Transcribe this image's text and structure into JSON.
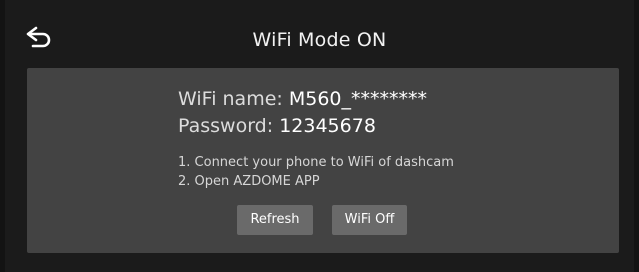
{
  "header": {
    "back_icon": "back-arrow-icon",
    "title": "WiFi Mode ON"
  },
  "wifi_info": {
    "name_label": "WiFi name: ",
    "name_value": "M560_********",
    "password_label": "Password: ",
    "password_value": "12345678"
  },
  "instructions": [
    "1. Connect your phone to WiFi of dashcam",
    "2. Open AZDOME APP"
  ],
  "buttons": {
    "refresh_label": "Refresh",
    "wifi_off_label": "WiFi Off"
  },
  "colors": {
    "background": "#1b1b1b",
    "panel": "#434343",
    "button": "#6a6a6a",
    "text": "#ffffff"
  }
}
